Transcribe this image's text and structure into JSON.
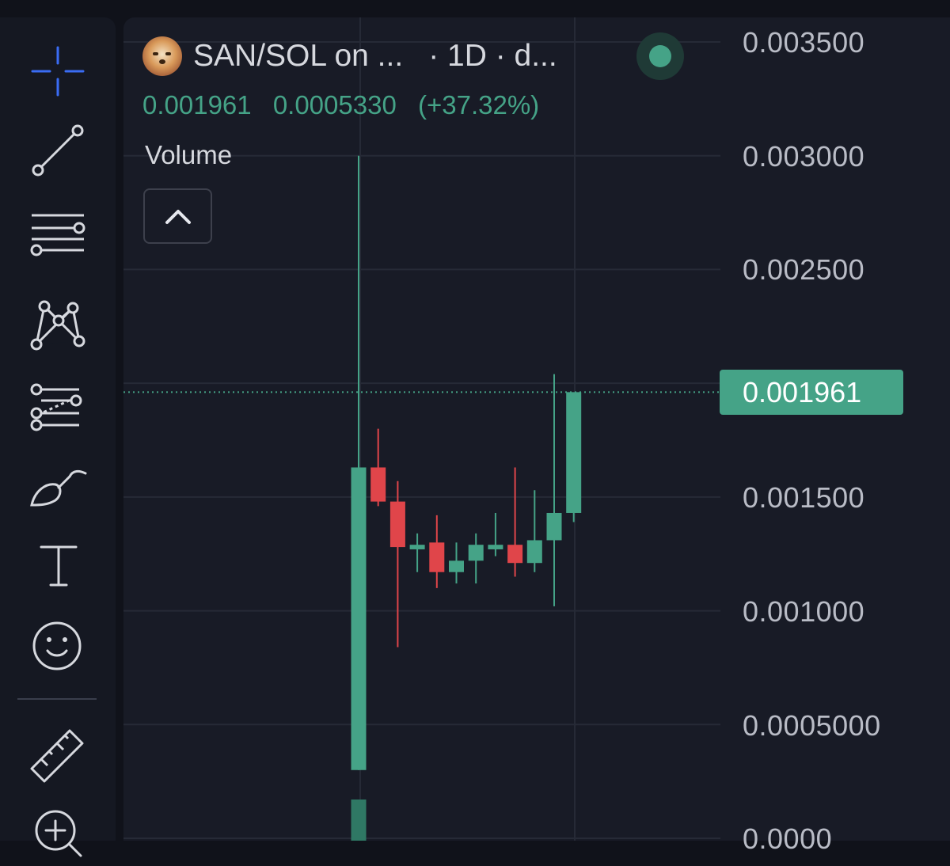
{
  "header": {
    "symbol": "SAN/SOL on ...",
    "meta": "· 1D · d...",
    "avatar_icon": "shiba-dog-avatar",
    "live_indicator_color": "#45a387"
  },
  "legend": {
    "last_price": "0.001961",
    "change": "0.0005330",
    "change_percent": "(+37.32%)",
    "volume_label": "Volume"
  },
  "colors": {
    "up": "#45a387",
    "down": "#e0454a",
    "background": "#181b26",
    "toolbar": "#151822",
    "price_line": "#45a387"
  },
  "toolbar": {
    "tools": [
      {
        "name": "crosshair-icon"
      },
      {
        "name": "trend-line-icon"
      },
      {
        "name": "horizontal-lines-icon"
      },
      {
        "name": "pattern-icon"
      },
      {
        "name": "fib-retracement-icon"
      },
      {
        "name": "brush-icon"
      },
      {
        "name": "text-icon"
      },
      {
        "name": "emoji-icon"
      },
      {
        "name": "ruler-icon"
      },
      {
        "name": "zoom-in-icon"
      }
    ]
  },
  "price_axis": {
    "ticks": [
      "0.003500",
      "0.003000",
      "0.002500",
      "0.001500",
      "0.001000",
      "0.0005000",
      "0.0000"
    ],
    "current_price_label": "0.001961"
  },
  "chart_data": {
    "type": "candlestick",
    "interval": "1D",
    "ylim": [
      0,
      0.0035
    ],
    "grid": true,
    "current_price": 0.001961,
    "candles": [
      {
        "open": 0.0003,
        "high": 0.003,
        "low": 0.0003,
        "close": 0.00163
      },
      {
        "open": 0.00163,
        "high": 0.0018,
        "low": 0.00146,
        "close": 0.00148
      },
      {
        "open": 0.00148,
        "high": 0.00157,
        "low": 0.00084,
        "close": 0.00128
      },
      {
        "open": 0.00127,
        "high": 0.00134,
        "low": 0.00117,
        "close": 0.00129
      },
      {
        "open": 0.0013,
        "high": 0.00142,
        "low": 0.0011,
        "close": 0.00117
      },
      {
        "open": 0.00117,
        "high": 0.0013,
        "low": 0.00112,
        "close": 0.00122
      },
      {
        "open": 0.00122,
        "high": 0.00134,
        "low": 0.00112,
        "close": 0.00129
      },
      {
        "open": 0.00127,
        "high": 0.00143,
        "low": 0.00124,
        "close": 0.00129
      },
      {
        "open": 0.00129,
        "high": 0.00163,
        "low": 0.00115,
        "close": 0.00121
      },
      {
        "open": 0.00121,
        "high": 0.00153,
        "low": 0.00117,
        "close": 0.00131
      },
      {
        "open": 0.00131,
        "high": 0.00204,
        "low": 0.00102,
        "close": 0.00143
      },
      {
        "open": 0.00143,
        "high": 0.00196,
        "low": 0.00139,
        "close": 0.001961
      }
    ]
  }
}
